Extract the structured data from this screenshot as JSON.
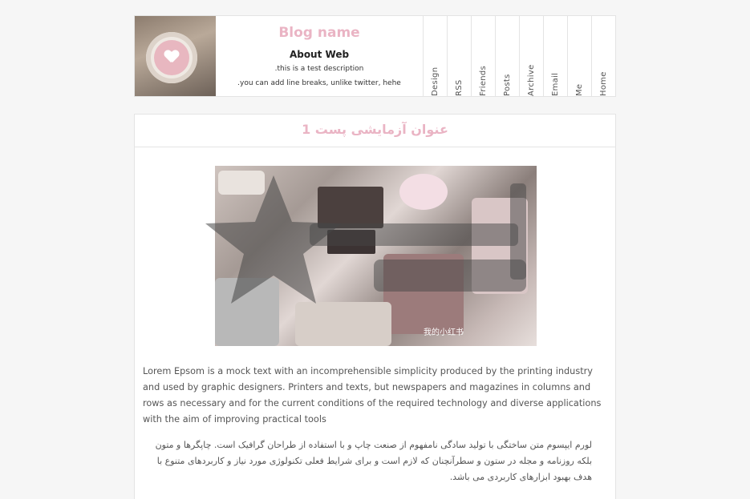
{
  "header": {
    "blog_name": "Blog name",
    "about_title": "About Web",
    "description": ".this is a test description",
    "description_line2": ".you can add line breaks, unlike twitter, hehe"
  },
  "nav": {
    "items": [
      {
        "label": "Design"
      },
      {
        "label": "RSS"
      },
      {
        "label": "Friends"
      },
      {
        "label": "Posts"
      },
      {
        "label": "Archive"
      },
      {
        "label": "Email"
      },
      {
        "label": "Me"
      },
      {
        "label": "Home"
      }
    ]
  },
  "post": {
    "title": "عنوان آزمایشی پست 1",
    "image_caption": "我的小红书",
    "paragraph_en": "Lorem Epsom is a mock text with an incomprehensible simplicity produced by the printing industry and used by graphic designers. Printers and texts, but newspapers and magazines in columns and rows as necessary and for the current conditions of the required technology and diverse applications with the aim of improving practical tools",
    "paragraph_fa": "لورم ایپسوم متن ساختگی با تولید سادگی نامفهوم از صنعت چاپ و با استفاده از طراحان گرافیک است. چاپگرها و متون بلکه روزنامه و مجله در ستون و سطرآنچنان که لازم است و برای شرایط فعلی تکنولوژی مورد نیاز و کاربردهای متنوع با هدف بهبود ابزارهای کاربردی می باشد."
  },
  "colors": {
    "accent_pink": "#eab4c4",
    "border": "#e4e4e4",
    "background": "#f6f6f6"
  },
  "icons": {
    "watermark": "star-logo-watermark"
  }
}
